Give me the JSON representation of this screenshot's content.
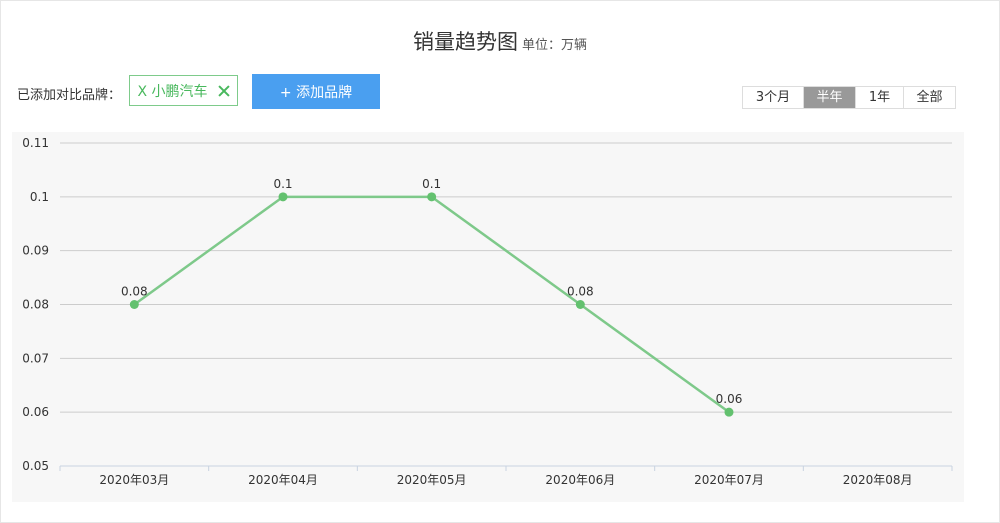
{
  "header": {
    "title": "销量趋势图",
    "unit": "单位：万辆"
  },
  "brand_compare": {
    "label": "已添加对比品牌：",
    "chip_text": "X 小鹏汽车",
    "add_button_label": "+ 添加品牌"
  },
  "range_tabs": [
    {
      "label": "3个月",
      "active": false
    },
    {
      "label": "半年",
      "active": true
    },
    {
      "label": "1年",
      "active": false
    },
    {
      "label": "全部",
      "active": false
    }
  ],
  "colors": {
    "series_line": "#7ec98a",
    "series_point": "#63c16f",
    "accent_button": "#4a9ff0",
    "active_tab": "#999999"
  },
  "chart_data": {
    "type": "line",
    "title": "销量趋势图",
    "unit": "单位：万辆",
    "categories": [
      "2020年03月",
      "2020年04月",
      "2020年05月",
      "2020年06月",
      "2020年07月",
      "2020年08月"
    ],
    "series": [
      {
        "values": [
          0.08,
          0.1,
          0.1,
          0.08,
          0.06,
          null
        ]
      }
    ],
    "data_labels": [
      "0.08",
      "0.1",
      "0.1",
      "0.08",
      "0.06",
      ""
    ],
    "y_ticks": [
      "0.05",
      "0.06",
      "0.07",
      "0.08",
      "0.09",
      "0.1",
      "0.11"
    ],
    "ylim": [
      0.05,
      0.11
    ],
    "grid": true,
    "legend": "none"
  }
}
